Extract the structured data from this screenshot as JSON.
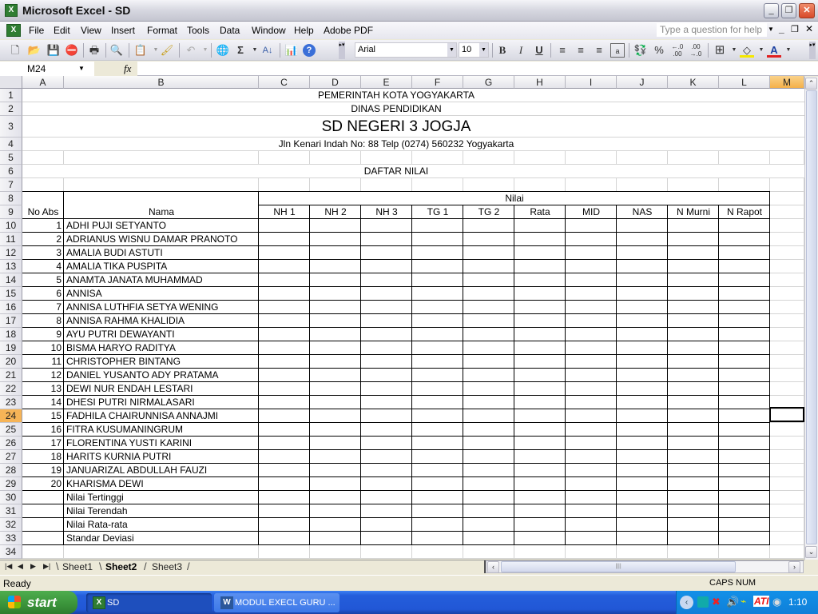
{
  "window": {
    "title": "Microsoft Excel - SD",
    "controls": [
      "minimize",
      "restore",
      "close"
    ]
  },
  "menu": {
    "items": [
      "File",
      "Edit",
      "View",
      "Insert",
      "Format",
      "Tools",
      "Data",
      "Window",
      "Help",
      "Adobe PDF"
    ],
    "help_placeholder": "Type a question for help"
  },
  "toolbar": {
    "font_name": "Arial",
    "font_size": "10",
    "buttons": [
      "new",
      "open",
      "save",
      "permission",
      "print",
      "print-preview",
      "paste",
      "format-painter",
      "undo",
      "hyperlink",
      "autosum",
      "sort-ascending",
      "chart-wizard",
      "help",
      "bold",
      "italic",
      "underline",
      "align-left",
      "center",
      "align-right",
      "merge-center",
      "currency",
      "percent",
      "increase-decimal",
      "decrease-decimal",
      "borders",
      "fill-color",
      "font-color"
    ],
    "bold_label": "B",
    "italic_label": "I",
    "underline_label": "U",
    "percent_label": "%",
    "autosum_label": "Σ"
  },
  "formula_bar": {
    "name_box": "M24",
    "fx_label": "fx",
    "content": ""
  },
  "sheet": {
    "columns": [
      "A",
      "B",
      "C",
      "D",
      "E",
      "F",
      "G",
      "H",
      "I",
      "J",
      "K",
      "L",
      "M"
    ],
    "active_column": "M",
    "active_row": "24",
    "active_cell": "M24",
    "rows": [
      "1",
      "2",
      "3",
      "4",
      "5",
      "6",
      "7",
      "8",
      "9",
      "10",
      "11",
      "12",
      "13",
      "14",
      "15",
      "16",
      "17",
      "18",
      "19",
      "20",
      "21",
      "22",
      "23",
      "24",
      "25",
      "26",
      "27",
      "28",
      "29",
      "30",
      "31",
      "32",
      "33",
      "34"
    ],
    "header": {
      "line1": "PEMERINTAH KOTA YOGYAKARTA",
      "line2": "DINAS PENDIDIKAN",
      "school": "SD NEGERI 3 JOGJA",
      "address": "Jln Kenari Indah No: 88 Telp (0274) 560232 Yogyakarta",
      "list_title": "DAFTAR NILAI"
    },
    "table": {
      "col_no_abs": "No Abs",
      "col_nama": "Nama",
      "group_nilai": "Nilai",
      "nilai_columns": [
        "NH 1",
        "NH 2",
        "NH 3",
        "TG 1",
        "TG 2",
        "Rata",
        "MID",
        "NAS",
        "N Murni",
        "N Rapot"
      ],
      "students": [
        {
          "no": "1",
          "name": "ADHI PUJI SETYANTO"
        },
        {
          "no": "2",
          "name": "ADRIANUS WISNU DAMAR PRANOTO"
        },
        {
          "no": "3",
          "name": "AMALIA BUDI ASTUTI"
        },
        {
          "no": "4",
          "name": "AMALIA TIKA PUSPITA"
        },
        {
          "no": "5",
          "name": "ANAMTA JANATA MUHAMMAD"
        },
        {
          "no": "6",
          "name": "ANNISA"
        },
        {
          "no": "7",
          "name": "ANNISA LUTHFIA SETYA WENING"
        },
        {
          "no": "8",
          "name": "ANNISA RAHMA KHALIDIA"
        },
        {
          "no": "9",
          "name": "AYU PUTRI DEWAYANTI"
        },
        {
          "no": "10",
          "name": "BISMA HARYO RADITYA"
        },
        {
          "no": "11",
          "name": "CHRISTOPHER BINTANG"
        },
        {
          "no": "12",
          "name": "DANIEL YUSANTO ADY PRATAMA"
        },
        {
          "no": "13",
          "name": "DEWI NUR ENDAH LESTARI"
        },
        {
          "no": "14",
          "name": "DHESI PUTRI NIRMALASARI"
        },
        {
          "no": "15",
          "name": "FADHILA CHAIRUNNISA ANNAJMI"
        },
        {
          "no": "16",
          "name": "FITRA KUSUMANINGRUM"
        },
        {
          "no": "17",
          "name": "FLORENTINA YUSTI KARINI"
        },
        {
          "no": "18",
          "name": "HARITS KURNIA PUTRI"
        },
        {
          "no": "19",
          "name": "JANUARIZAL ABDULLAH FAUZI"
        },
        {
          "no": "20",
          "name": "KHARISMA DEWI"
        }
      ],
      "summary_rows": [
        "Nilai Tertinggi",
        "Nilai Terendah",
        "Nilai Rata-rata",
        "Standar Deviasi"
      ]
    }
  },
  "sheet_tabs": {
    "tabs": [
      "Sheet1",
      "Sheet2",
      "Sheet3"
    ],
    "active": "Sheet2"
  },
  "status": {
    "left": "Ready",
    "indicators": "CAPS NUM"
  },
  "taskbar": {
    "start_label": "start",
    "buttons": [
      "SD",
      "MODUL EXECL GURU ..."
    ],
    "active_button": "SD",
    "clock": "1:10"
  }
}
